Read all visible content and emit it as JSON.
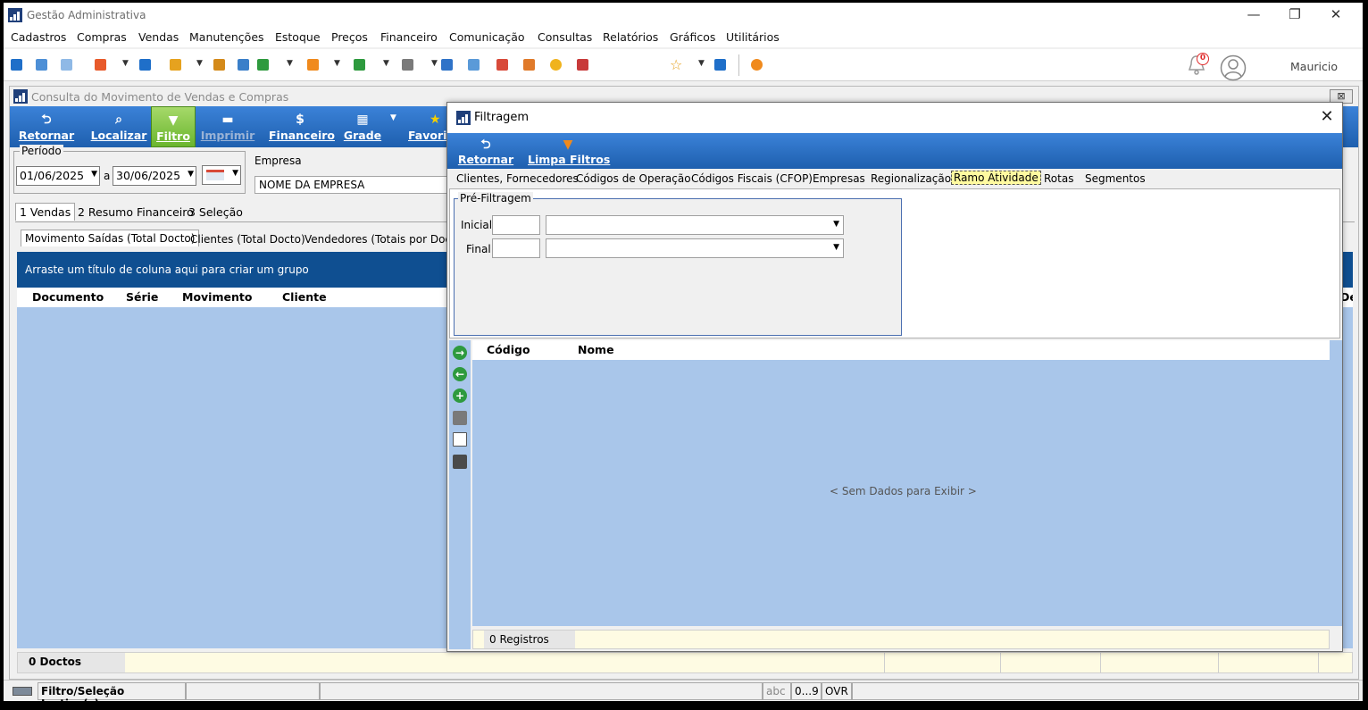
{
  "app": {
    "title": "Gestão Administrativa",
    "menu": [
      "Cadastros",
      "Compras",
      "Vendas",
      "Manutenções",
      "Estoque",
      "Preços",
      "Financeiro",
      "Comunicação",
      "Consultas",
      "Relatórios",
      "Gráficos",
      "Utilitários"
    ],
    "notification_count": "0",
    "user": "Mauricio",
    "window_controls": {
      "minimize": "—",
      "restore": "❐",
      "close": "✕"
    }
  },
  "child": {
    "title": "Consulta do Movimento de Vendas e Compras",
    "close_label": "⊠",
    "toolbar": {
      "retornar": "Retornar",
      "localizar": "Localizar",
      "filtro": "Filtro",
      "imprimir": "Imprimir",
      "financeiro": "Financeiro",
      "grade": "Grade",
      "favoritos": "Favorit"
    },
    "periodo": {
      "label": "Período",
      "start": "01/06/2025",
      "separator": "a",
      "end": "30/06/2025"
    },
    "empresa": {
      "label": "Empresa",
      "value": "NOME DA EMPRESA"
    },
    "main_tabs": [
      "1 Vendas",
      "2 Resumo Financeiro",
      "3 Seleção"
    ],
    "sub_tabs": [
      "Movimento Saídas (Total Docto)",
      "Clientes (Total Docto)",
      "Vendedores (Totais por Docto)"
    ],
    "group_hint": "Arraste um título de coluna aqui para criar um grupo",
    "columns": [
      "Documento",
      "Série",
      "Movimento",
      "Cliente",
      "De"
    ],
    "footer_count": "0 Doctos"
  },
  "statusbar": {
    "filter_status": "Filtro/Seleção Inativo(s)",
    "abc": "abc",
    "num": "0...9",
    "ovr": "OVR"
  },
  "dialog": {
    "title": "Filtragem",
    "toolbar": {
      "retornar": "Retornar",
      "limpa": "Limpa Filtros"
    },
    "tabs": [
      "Clientes, Fornecedores",
      "Códigos de Operação",
      "Códigos Fiscais (CFOP)",
      "Empresas",
      "Regionalização",
      "Ramo Atividade",
      "Rotas",
      "Segmentos"
    ],
    "selected_tab": "Ramo Atividade",
    "pre_filtragem": {
      "label": "Pré-Filtragem",
      "inicial": "Inicial",
      "final": "Final"
    },
    "columns": [
      "Código",
      "Nome"
    ],
    "no_data": "< Sem Dados para Exibir >",
    "footer_count": "0 Registros"
  },
  "colors": {
    "toolbar_blue": "#2f73c8",
    "group_bar": "#0f4f91",
    "grid_body": "#a9c6ea",
    "active_filter": "#8cc63f",
    "footer_yellow": "#fefbe3",
    "selected_tab": "#fffaa0"
  }
}
